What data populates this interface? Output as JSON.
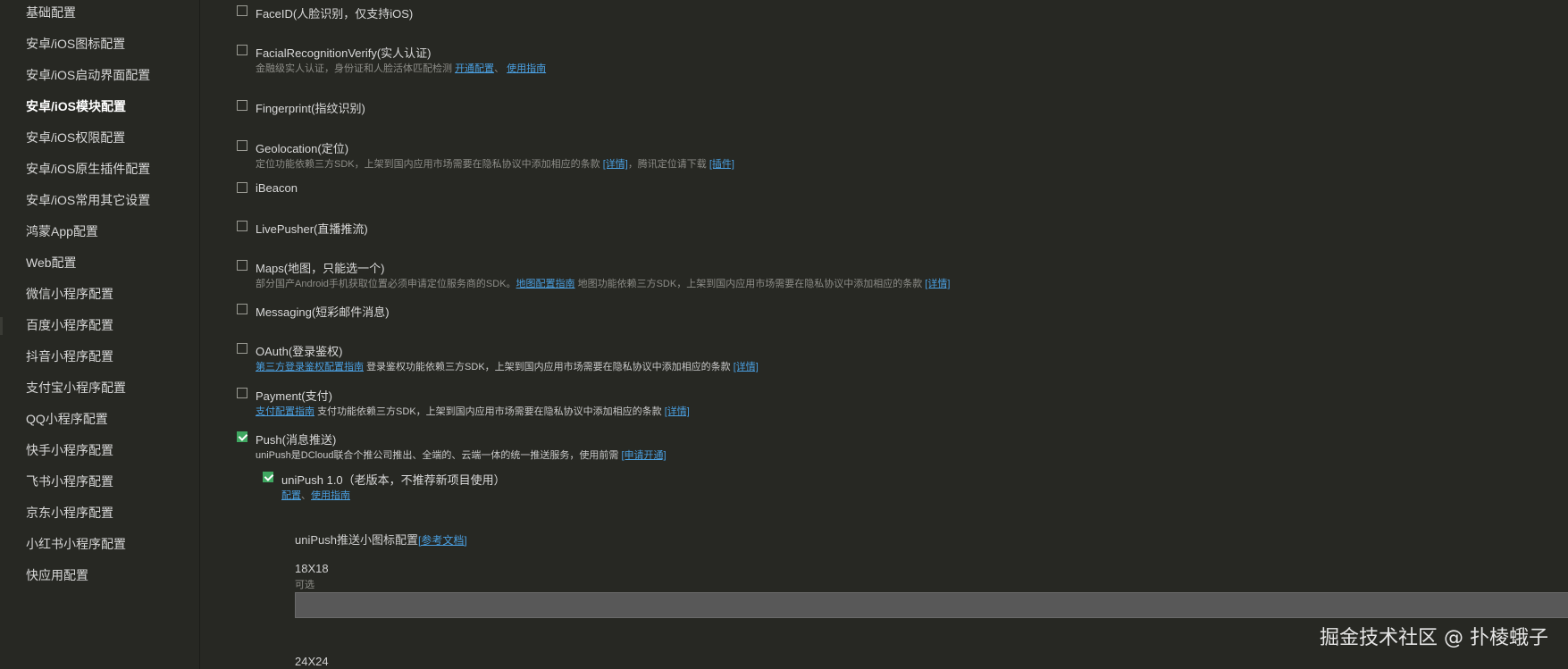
{
  "sidebar": {
    "items": [
      {
        "label": "基础配置"
      },
      {
        "label": "安卓/iOS图标配置"
      },
      {
        "label": "安卓/iOS启动界面配置"
      },
      {
        "label": "安卓/iOS模块配置"
      },
      {
        "label": "安卓/iOS权限配置"
      },
      {
        "label": "安卓/iOS原生插件配置"
      },
      {
        "label": "安卓/iOS常用其它设置"
      },
      {
        "label": "鸿蒙App配置"
      },
      {
        "label": "Web配置"
      },
      {
        "label": "微信小程序配置"
      },
      {
        "label": "百度小程序配置"
      },
      {
        "label": "抖音小程序配置"
      },
      {
        "label": "支付宝小程序配置"
      },
      {
        "label": "QQ小程序配置"
      },
      {
        "label": "快手小程序配置"
      },
      {
        "label": "飞书小程序配置"
      },
      {
        "label": "京东小程序配置"
      },
      {
        "label": "小红书小程序配置"
      },
      {
        "label": "快应用配置"
      }
    ],
    "active_index": 3
  },
  "modules": {
    "faceid": {
      "title": "FaceID(人脸识别，仅支持iOS)",
      "checked": false
    },
    "facial": {
      "title": "FacialRecognitionVerify(实人认证)",
      "desc": "金融级实人认证，身份证和人脸活体匹配检测",
      "link1": "开通配置",
      "sep": "、",
      "link2": "使用指南",
      "checked": false
    },
    "fingerprint": {
      "title": "Fingerprint(指纹识别)",
      "checked": false
    },
    "geolocation": {
      "title": "Geolocation(定位)",
      "desc": "定位功能依赖三方SDK，上架到国内应用市场需要在隐私协议中添加相应的条款",
      "link1": "[详情]",
      "mid": "，腾讯定位请下载",
      "link2": "[插件]",
      "checked": false
    },
    "ibeacon": {
      "title": "iBeacon",
      "checked": false
    },
    "livepusher": {
      "title": "LivePusher(直播推流)",
      "checked": false
    },
    "maps": {
      "title": "Maps(地图，只能选一个)",
      "desc": "部分国产Android手机获取位置必须申请定位服务商的SDK。",
      "link1": "地图配置指南",
      "mid": "地图功能依赖三方SDK，上架到国内应用市场需要在隐私协议中添加相应的条款",
      "link2": "[详情]",
      "checked": false
    },
    "messaging": {
      "title": "Messaging(短彩邮件消息)",
      "checked": false
    },
    "oauth": {
      "title": "OAuth(登录鉴权)",
      "link1": "第三方登录鉴权配置指南",
      "mid": "登录鉴权功能依赖三方SDK，上架到国内应用市场需要在隐私协议中添加相应的条款",
      "link2": "[详情]",
      "checked": false
    },
    "payment": {
      "title": "Payment(支付)",
      "link1": "支付配置指南",
      "mid": "支付功能依赖三方SDK，上架到国内应用市场需要在隐私协议中添加相应的条款",
      "link2": "[详情]",
      "checked": false
    },
    "push": {
      "title": "Push(消息推送)",
      "desc": "uniPush是DCloud联合个推公司推出、全端的、云端一体的统一推送服务，使用前需",
      "link1": "[申请开通]",
      "checked": true
    },
    "unipush": {
      "title": "uniPush 1.0（老版本，不推荐新项目使用）",
      "link1": "配置",
      "sep": "、",
      "link2": "使用指南",
      "checked": true
    }
  },
  "icon_config": {
    "title": "uniPush推送小图标配置",
    "doc_link": "[参考文档]",
    "size18": "18X18",
    "optional": "可选",
    "size24": "24X24"
  },
  "watermark": "掘金技术社区 @ 扑棱蛾子"
}
